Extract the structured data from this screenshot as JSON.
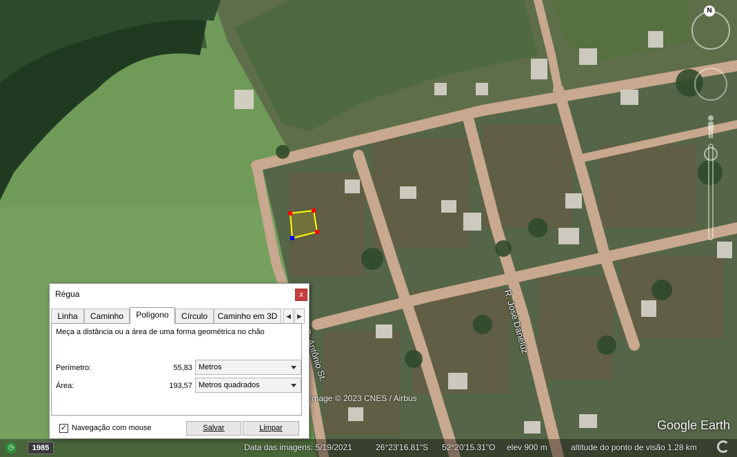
{
  "window": {
    "title": "Régua"
  },
  "tabs": [
    {
      "label": "Linha"
    },
    {
      "label": "Caminho"
    },
    {
      "label": "Polígono"
    },
    {
      "label": "Círculo"
    },
    {
      "label": "Caminho em 3D"
    }
  ],
  "active_tab": "Polígono",
  "panel": {
    "description": "Meça a distância ou a área de uma forma geométrica no chão",
    "perimeter": {
      "label": "Perímetro:",
      "value": "55,83",
      "unit": "Metros"
    },
    "area": {
      "label": "Área:",
      "value": "193,57",
      "unit": "Metros quadrados"
    }
  },
  "footer": {
    "mouse_navigation": {
      "label": "Navegação com mouse",
      "checked": true
    },
    "save_label": "Salvar",
    "clear_label": "Limpar"
  },
  "map": {
    "attribution": "Image © 2023 CNES / Airbus",
    "logo": "Google Earth",
    "streets": [
      "R. José Danelúz",
      "R. Antônio St."
    ],
    "compass_letter": "N"
  },
  "statusbar": {
    "history_year": "1985",
    "imagery_date": "Data das imagens: 5/19/2021",
    "latitude": "26°23'16.81\"S",
    "longitude": "52°20'15.31\"O",
    "elevation": "elev  900 m",
    "eye_altitude": "altitude do ponto de visão  1.28 km"
  },
  "colors": {
    "polygon_stroke": "#ffff00",
    "vertex": "#ff0000",
    "vertex_active": "#0000ff",
    "close_button": "#c83d3d"
  }
}
